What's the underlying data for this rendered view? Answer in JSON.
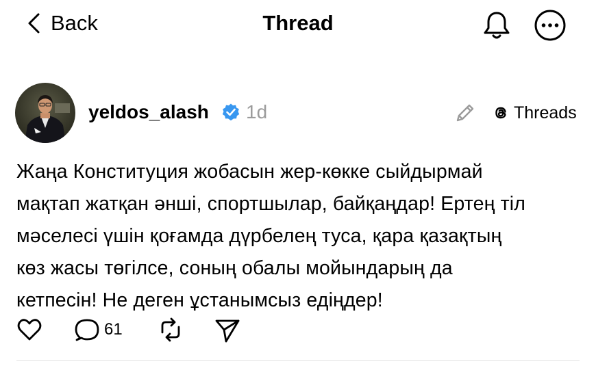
{
  "header": {
    "back_label": "Back",
    "title": "Thread",
    "icons": [
      "chevron-left-icon",
      "bell-icon",
      "more-icon"
    ]
  },
  "post": {
    "username": "yeldos_alash",
    "verified": true,
    "time": "1d",
    "badge_label": "Threads",
    "text": "Жаңа Конституция жобасын жер-көкке сыйдырмай\nмақтап жатқан әнші, спортшылар, байқаңдар! Ертең тіл\nмәселесі үшін қоғамда дүрбелең туса, қара қазақтың\nкөз жасы төгілсе, соның обалы мойындарың да\nкетпесін! Не деген ұстанымсыз едіңдер!",
    "actions": {
      "reply_count": "61",
      "icons": [
        "heart-icon",
        "comment-icon",
        "repost-icon",
        "send-icon"
      ]
    }
  },
  "colors": {
    "text": "#000000",
    "muted": "#9b9b9b",
    "verified_badge": "#3897f0",
    "divider": "#e2e2e2"
  }
}
